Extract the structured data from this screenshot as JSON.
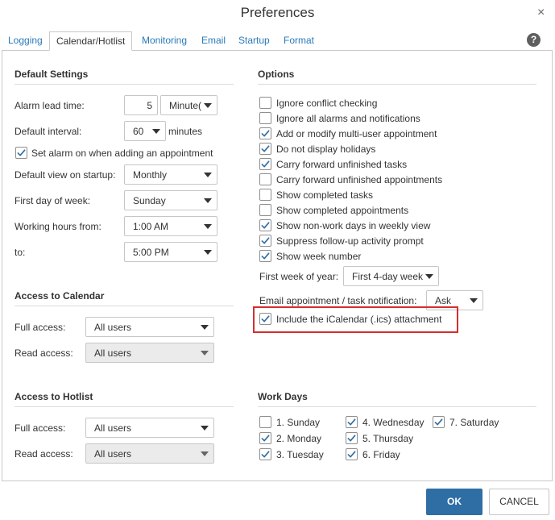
{
  "window": {
    "title": "Preferences",
    "close_glyph": "×"
  },
  "tabs": [
    {
      "label": "Logging",
      "active": false
    },
    {
      "label": "Calendar/Hotlist",
      "active": true
    },
    {
      "label": "Monitoring",
      "active": false
    },
    {
      "label": "Email",
      "active": false
    },
    {
      "label": "Startup",
      "active": false
    },
    {
      "label": "Format",
      "active": false
    }
  ],
  "help": {
    "glyph": "?",
    "icon": "help-circle-icon"
  },
  "default_settings": {
    "title": "Default Settings",
    "alarm_lead_time": {
      "label": "Alarm lead time:",
      "value": "5",
      "unit": "Minute("
    },
    "default_interval": {
      "label": "Default interval:",
      "value": "60",
      "unit_label": "minutes"
    },
    "set_alarm": {
      "label": "Set alarm on when adding an appointment",
      "checked": true
    },
    "default_view": {
      "label": "Default view on startup:",
      "value": "Monthly"
    },
    "first_day": {
      "label": "First day of week:",
      "value": "Sunday"
    },
    "working_from": {
      "label": "Working hours from:",
      "value": "1:00 AM"
    },
    "working_to": {
      "label": "to:",
      "value": "5:00 PM"
    }
  },
  "access_calendar": {
    "title": "Access to Calendar",
    "full": {
      "label": "Full access:",
      "value": "All users"
    },
    "read": {
      "label": "Read access:",
      "value": "All users"
    }
  },
  "access_hotlist": {
    "title": "Access to Hotlist",
    "full": {
      "label": "Full access:",
      "value": "All users"
    },
    "read": {
      "label": "Read access:",
      "value": "All users"
    }
  },
  "options": {
    "title": "Options",
    "items": [
      {
        "label": "Ignore conflict checking",
        "checked": false
      },
      {
        "label": "Ignore all alarms and notifications",
        "checked": false
      },
      {
        "label": "Add or modify multi-user appointment",
        "checked": true
      },
      {
        "label": "Do not display holidays",
        "checked": true
      },
      {
        "label": "Carry forward unfinished tasks",
        "checked": true
      },
      {
        "label": "Carry forward unfinished appointments",
        "checked": false
      },
      {
        "label": "Show completed tasks",
        "checked": false
      },
      {
        "label": "Show completed appointments",
        "checked": false
      },
      {
        "label": "Show non-work days in weekly view",
        "checked": true
      },
      {
        "label": "Suppress follow-up activity prompt",
        "checked": true
      },
      {
        "label": "Show week number",
        "checked": true
      }
    ],
    "first_week": {
      "label": "First week of year:",
      "value": "First 4-day week"
    },
    "email_notification": {
      "label": "Email appointment / task notification:",
      "value": "Ask"
    },
    "ical": {
      "label": "Include the iCalendar (.ics) attachment",
      "checked": true
    }
  },
  "work_days": {
    "title": "Work Days",
    "days": [
      {
        "label": "1. Sunday",
        "checked": false
      },
      {
        "label": "2. Monday",
        "checked": true
      },
      {
        "label": "3. Tuesday",
        "checked": true
      },
      {
        "label": "4. Wednesday",
        "checked": true
      },
      {
        "label": "5. Thursday",
        "checked": true
      },
      {
        "label": "6. Friday",
        "checked": true
      },
      {
        "label": "7. Saturday",
        "checked": true
      }
    ]
  },
  "buttons": {
    "ok": "OK",
    "cancel": "CANCEL"
  },
  "colors": {
    "accent": "#2f6ea5",
    "tab_link": "#2a7ab9",
    "highlight": "#d32f2f",
    "check": "#2f6ea5"
  }
}
